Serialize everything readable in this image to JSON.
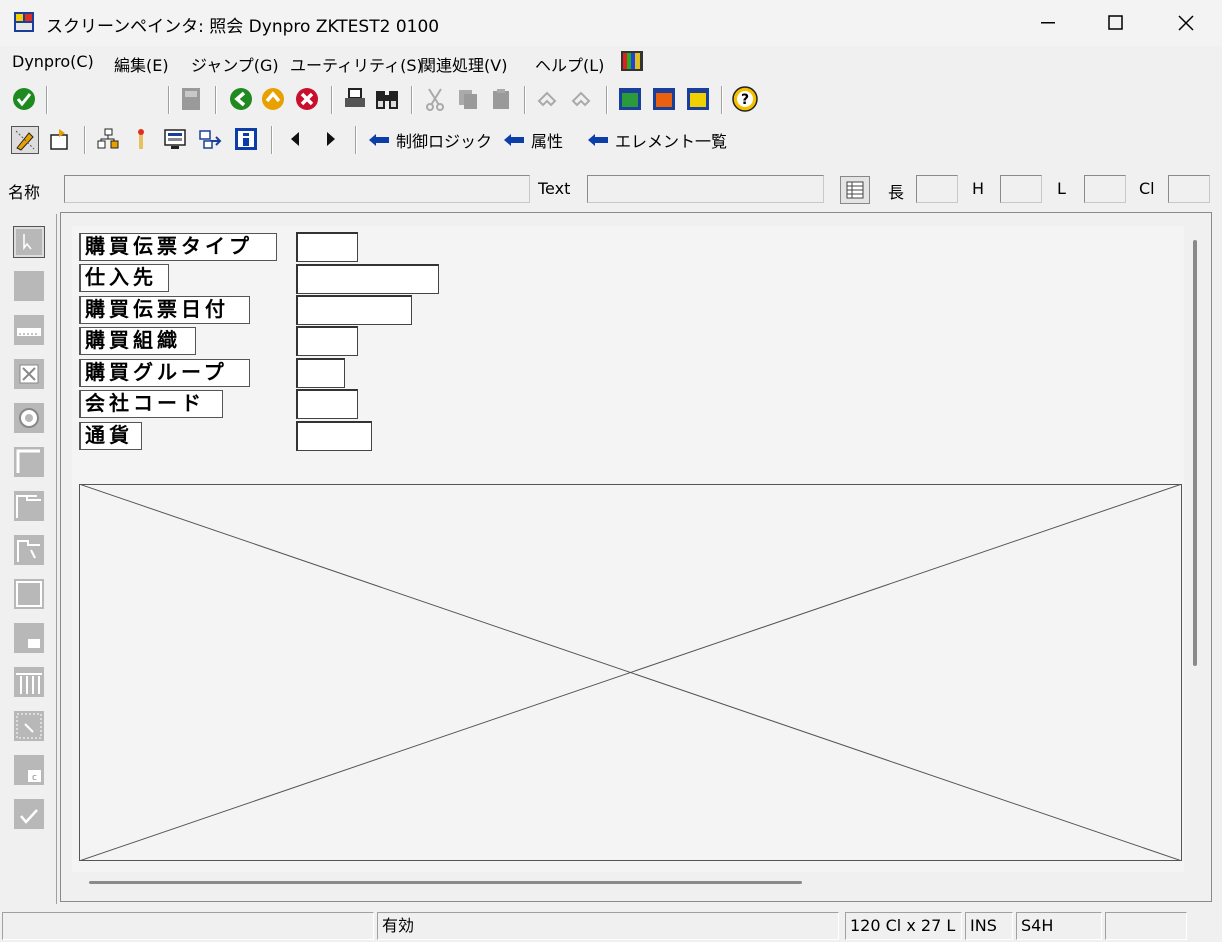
{
  "window": {
    "title": "スクリーンペインタ:  照会 Dynpro ZKTEST2 0100"
  },
  "menu": [
    {
      "label": "Dynpro(C)"
    },
    {
      "label": "編集(E)"
    },
    {
      "label": "ジャンプ(G)"
    },
    {
      "label": "ユーティリティ(S)"
    },
    {
      "label": "関連処理(V)"
    },
    {
      "label": "ヘルプ(L)"
    }
  ],
  "toolbar2": {
    "links": [
      "制御ロジック",
      "属性",
      "エレメント一覧"
    ]
  },
  "attrs": {
    "name_label": "名称",
    "text_label": "Text",
    "length_label": "長",
    "h_label": "H",
    "l_label": "L",
    "cl_label": "Cl"
  },
  "dynpro_fields": [
    {
      "label": "購買伝票タイプ"
    },
    {
      "label": "仕入先"
    },
    {
      "label": "購買伝票日付"
    },
    {
      "label": "購買組織"
    },
    {
      "label": "購買グループ"
    },
    {
      "label": "会社コード"
    },
    {
      "label": "通貨"
    }
  ],
  "status": {
    "mode": "有効",
    "size": "120 Cl x 27 L",
    "ins": "INS",
    "system": "S4H"
  },
  "colors": {
    "accent_blue": "#0b3ea8",
    "green": "#1f8a1f",
    "red": "#c8102e",
    "orange": "#e8a000"
  }
}
